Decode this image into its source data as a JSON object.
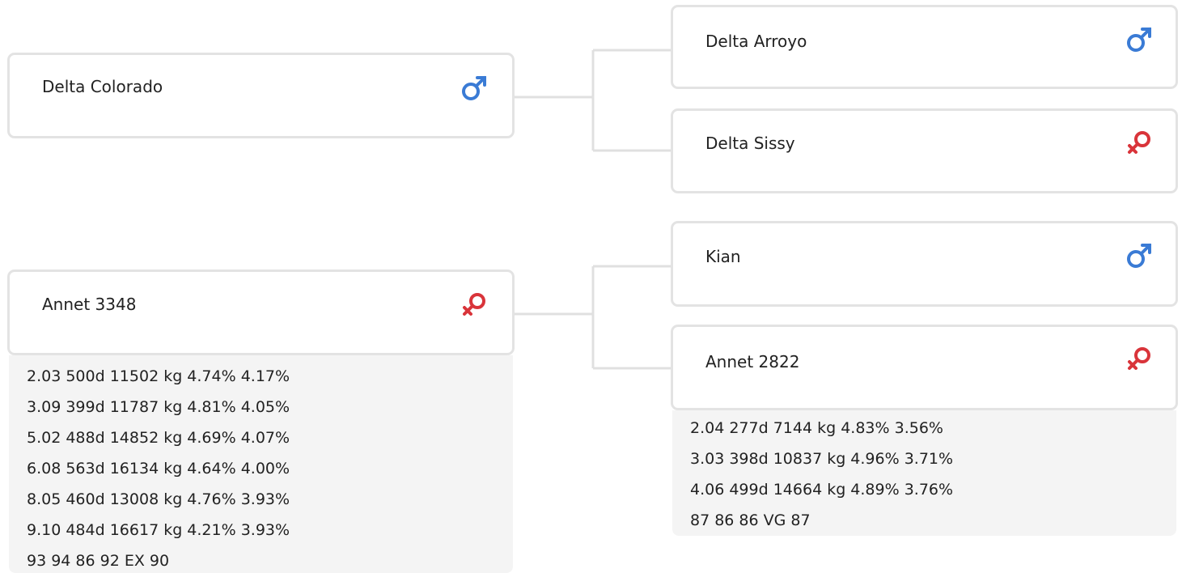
{
  "pedigree": {
    "sire": {
      "name": "Delta Colorado",
      "sex_icon": "male-symbol",
      "sire": {
        "name": "Delta Arroyo",
        "sex_icon": "male-symbol"
      },
      "dam": {
        "name": "Delta Sissy",
        "sex_icon": "female-symbol"
      }
    },
    "dam": {
      "name": "Annet 3348",
      "sex_icon": "female-symbol",
      "stats": [
        "2.03 500d 11502 kg 4.74% 4.17%",
        "3.09 399d 11787 kg 4.81% 4.05%",
        "5.02 488d 14852 kg 4.69% 4.07%",
        "6.08 563d 16134 kg 4.64% 4.00%",
        "8.05 460d 13008 kg 4.76% 3.93%",
        "9.10 484d 16617 kg 4.21% 3.93%",
        "93 94 86 92 EX 90"
      ],
      "sire": {
        "name": "Kian",
        "sex_icon": "male-symbol"
      },
      "dam": {
        "name": "Annet 2822",
        "sex_icon": "female-symbol",
        "stats": [
          "2.04 277d 7144 kg 4.83% 3.56%",
          "3.03 398d 10837 kg 4.96% 3.71%",
          "4.06 499d 14664 kg 4.89% 3.76%",
          "87 86 86 VG 87"
        ]
      }
    }
  },
  "colors": {
    "male": "#3a7bd5",
    "female": "#d9343a",
    "card_border": "#e3e3e3",
    "connector": "#e0e0e0",
    "stats_background": "#f4f4f4"
  }
}
